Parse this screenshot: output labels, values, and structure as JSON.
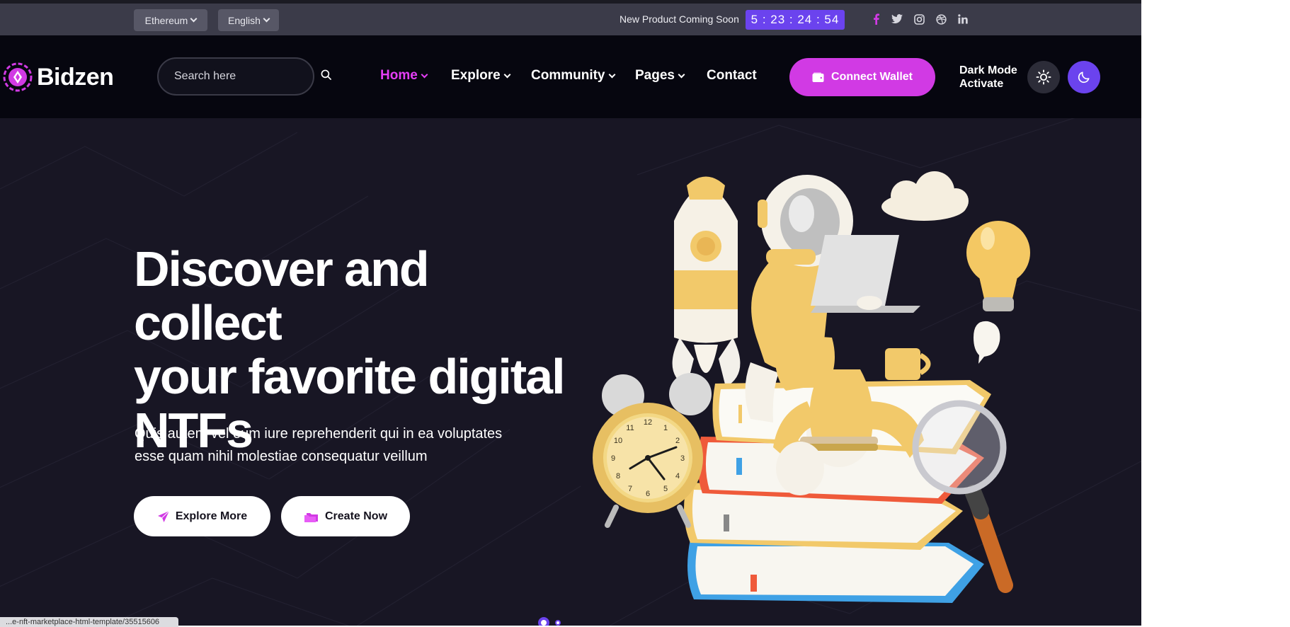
{
  "topbar": {
    "network_select": "Ethereum",
    "language_select": "English",
    "announcement": "New Product Coming Soon",
    "countdown": "5 : 23 : 24 : 54",
    "social": [
      "facebook-icon",
      "twitter-icon",
      "instagram-icon",
      "dribbble-icon",
      "linkedin-icon"
    ]
  },
  "header": {
    "logo_text": "Bidzen",
    "search_placeholder": "Search here",
    "nav": [
      {
        "label": "Home",
        "dropdown": true,
        "active": true
      },
      {
        "label": "Explore",
        "dropdown": true
      },
      {
        "label": "Community",
        "dropdown": true
      },
      {
        "label": "Pages",
        "dropdown": true
      },
      {
        "label": "Contact",
        "dropdown": false
      }
    ],
    "connect_wallet": "Connect Wallet",
    "dark_mode_line1": "Dark Mode",
    "dark_mode_line2": "Activate"
  },
  "hero": {
    "title_lines": [
      "Discover and collect",
      "your favorite digital",
      "NTFs"
    ],
    "subtitle_lines": [
      "Quis autem vel eum iure reprehenderit qui in ea voluptates",
      "esse quam nihil molestiae consequatur veillum"
    ],
    "explore_button": "Explore More",
    "create_button": "Create Now"
  },
  "status_bar_url": "...e-nft-marketplace-html-template/35515606",
  "colors": {
    "accent": "#d13ae4",
    "accent_text": "#e43ef6",
    "primary": "#6b43ee",
    "topbar_bg": "#3b3b49",
    "header_bg": "#06060f",
    "hero_bg": "#181624"
  }
}
